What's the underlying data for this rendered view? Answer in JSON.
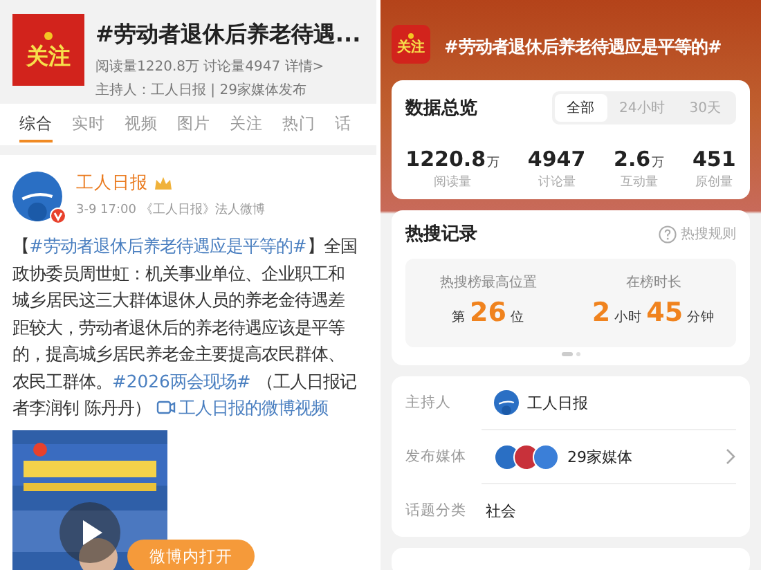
{
  "left": {
    "header": {
      "badge_text": "关注",
      "title": "#劳动者退休后养老待遇...",
      "stats": "阅读量1220.8万 讨论量4947 详情>",
      "host_line": "主持人：工人日报 | 29家媒体发布"
    },
    "tabs": [
      {
        "label": "综合",
        "selected": true
      },
      {
        "label": "实时",
        "selected": false
      },
      {
        "label": "视频",
        "selected": false
      },
      {
        "label": "图片",
        "selected": false
      },
      {
        "label": "关注",
        "selected": false
      },
      {
        "label": "热门",
        "selected": false
      },
      {
        "label": "话",
        "selected": false
      }
    ],
    "post": {
      "author": "工人日报",
      "verified": true,
      "time": "3-9 17:00 《工人日报》法人微博",
      "body": [
        {
          "kind": "text",
          "text": "【"
        },
        {
          "kind": "hashtag",
          "text": "#劳动者退休后养老待遇应是平等的#"
        },
        {
          "kind": "text",
          "text": "】全国政协委员周世虹：机关事业单位、企业职工和城乡居民这三大群体退休人员的养老金待遇差距较大，劳动者退休后的养老待遇应该是平等的，提高城乡居民养老金主要提高农民群体、农民工群体。"
        },
        {
          "kind": "hashtag",
          "text": "#2026两会现场#"
        },
        {
          "kind": "text",
          "text": " （工人日报记者李润钊 陈丹丹） "
        },
        {
          "kind": "video",
          "text": "工人日报的微博视频"
        }
      ],
      "open_button": "微博内打开"
    }
  },
  "right": {
    "header": {
      "badge_text": "关注",
      "title": "#劳动者退休后养老待遇应是平等的#"
    },
    "overview": {
      "title": "数据总览",
      "ranges": [
        {
          "label": "全部",
          "selected": true
        },
        {
          "label": "24小时",
          "selected": false
        },
        {
          "label": "30天",
          "selected": false
        }
      ],
      "stats": [
        {
          "value": "1220.8",
          "unit": "万",
          "label": "阅读量"
        },
        {
          "value": "4947",
          "label": "讨论量"
        },
        {
          "value": "2.6",
          "unit": "万",
          "label": "互动量"
        },
        {
          "value": "451",
          "label": "原创量"
        }
      ]
    },
    "hot_record": {
      "title": "热搜记录",
      "rules_link": "热搜规则",
      "items": [
        {
          "label": "热搜榜最高位置",
          "parts": [
            {
              "kind": "unit",
              "text": "第"
            },
            {
              "kind": "number",
              "text": "26"
            },
            {
              "kind": "unit",
              "text": "位"
            }
          ]
        },
        {
          "label": "在榜时长",
          "parts": [
            {
              "kind": "number",
              "text": "2"
            },
            {
              "kind": "unit",
              "text": "小时"
            },
            {
              "kind": "number",
              "text": "45"
            },
            {
              "kind": "unit",
              "text": "分钟"
            }
          ]
        }
      ]
    },
    "info": [
      {
        "label": "主持人",
        "kind": "host",
        "value": "工人日报",
        "chevron": false
      },
      {
        "label": "发布媒体",
        "kind": "media",
        "value": "29家媒体",
        "chevron": true
      },
      {
        "label": "话题分类",
        "kind": "plain",
        "value": "社会",
        "chevron": false
      }
    ]
  }
}
